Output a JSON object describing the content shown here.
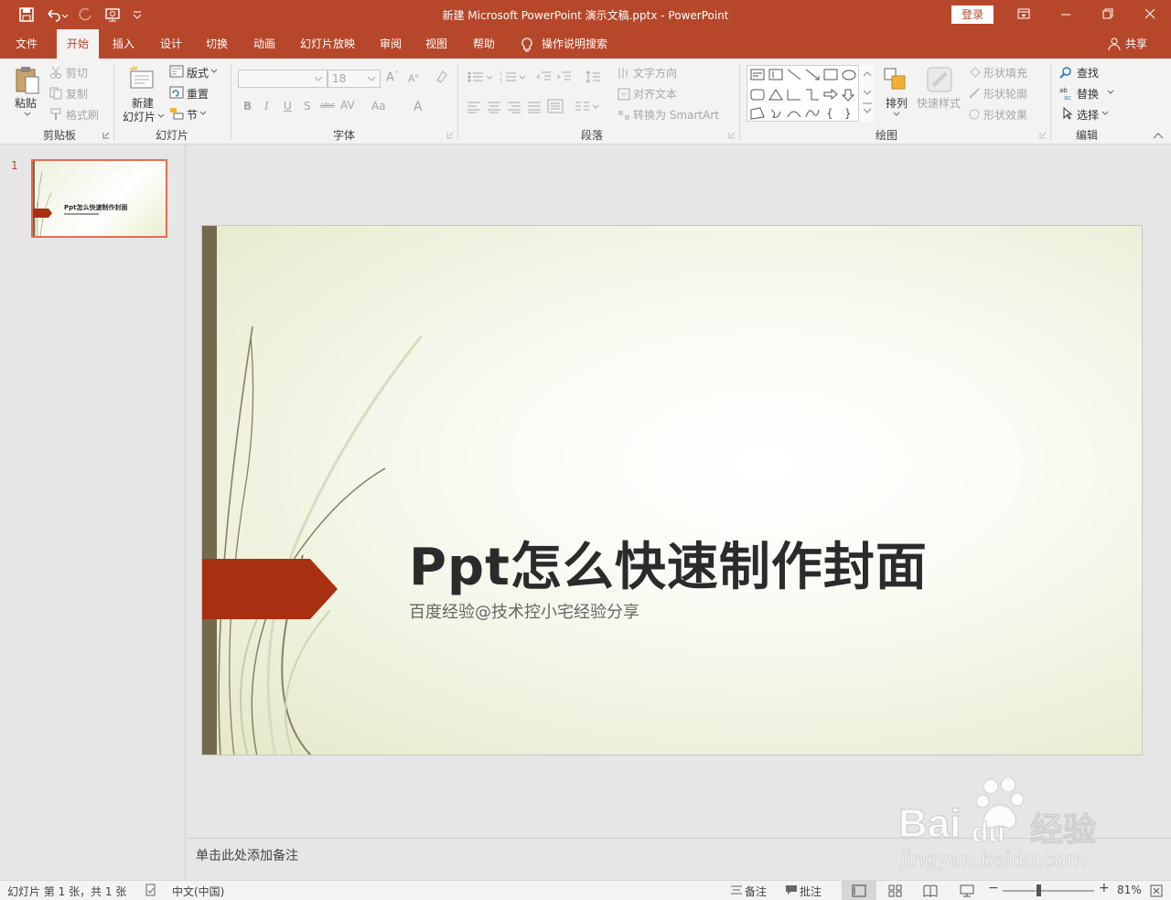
{
  "titlebar": {
    "title": "新建 Microsoft PowerPoint 演示文稿.pptx  -  PowerPoint",
    "login": "登录"
  },
  "tabs": [
    {
      "label": "文件"
    },
    {
      "label": "开始"
    },
    {
      "label": "插入"
    },
    {
      "label": "设计"
    },
    {
      "label": "切换"
    },
    {
      "label": "动画"
    },
    {
      "label": "幻灯片放映"
    },
    {
      "label": "审阅"
    },
    {
      "label": "视图"
    },
    {
      "label": "帮助"
    }
  ],
  "tell_me": "操作说明搜索",
  "share": "共享",
  "ribbon": {
    "clipboard": {
      "paste": "粘贴",
      "cut": "剪切",
      "copy": "复制",
      "format_painter": "格式刷",
      "label": "剪贴板"
    },
    "slides": {
      "new_slide_1": "新建",
      "new_slide_2": "幻灯片",
      "layout": "版式",
      "reset": "重置",
      "section": "节",
      "label": "幻灯片"
    },
    "font": {
      "size": "18",
      "label": "字体"
    },
    "paragraph": {
      "text_direction": "文字方向",
      "align_text": "对齐文本",
      "smartart": "转换为 SmartArt",
      "label": "段落"
    },
    "drawing": {
      "arrange": "排列",
      "quick_styles": "快速样式",
      "shape_fill": "形状填充",
      "shape_outline": "形状轮廓",
      "shape_effects": "形状效果",
      "label": "绘图"
    },
    "editing": {
      "find": "查找",
      "replace": "替换",
      "select": "选择",
      "label": "编辑"
    }
  },
  "thumbnail": {
    "number": "1",
    "title": "Ppt怎么快速制作封面"
  },
  "slide": {
    "title": "Ppt怎么快速制作封面",
    "subtitle": "百度经验@技术控小宅经验分享"
  },
  "notes_placeholder": "单击此处添加备注",
  "statusbar": {
    "slide_info": "幻灯片 第 1 张，共 1 张",
    "language": "中文(中国)",
    "notes": "备注",
    "comments": "批注",
    "zoom": "81%",
    "zoom_level": 0.81
  },
  "watermark": {
    "brand": "Bai经验",
    "url": "jingyan.baidu.com"
  },
  "colors": {
    "accent": "#b7472a",
    "slide_arrow": "#a83010",
    "slide_bar": "#736a4e"
  }
}
